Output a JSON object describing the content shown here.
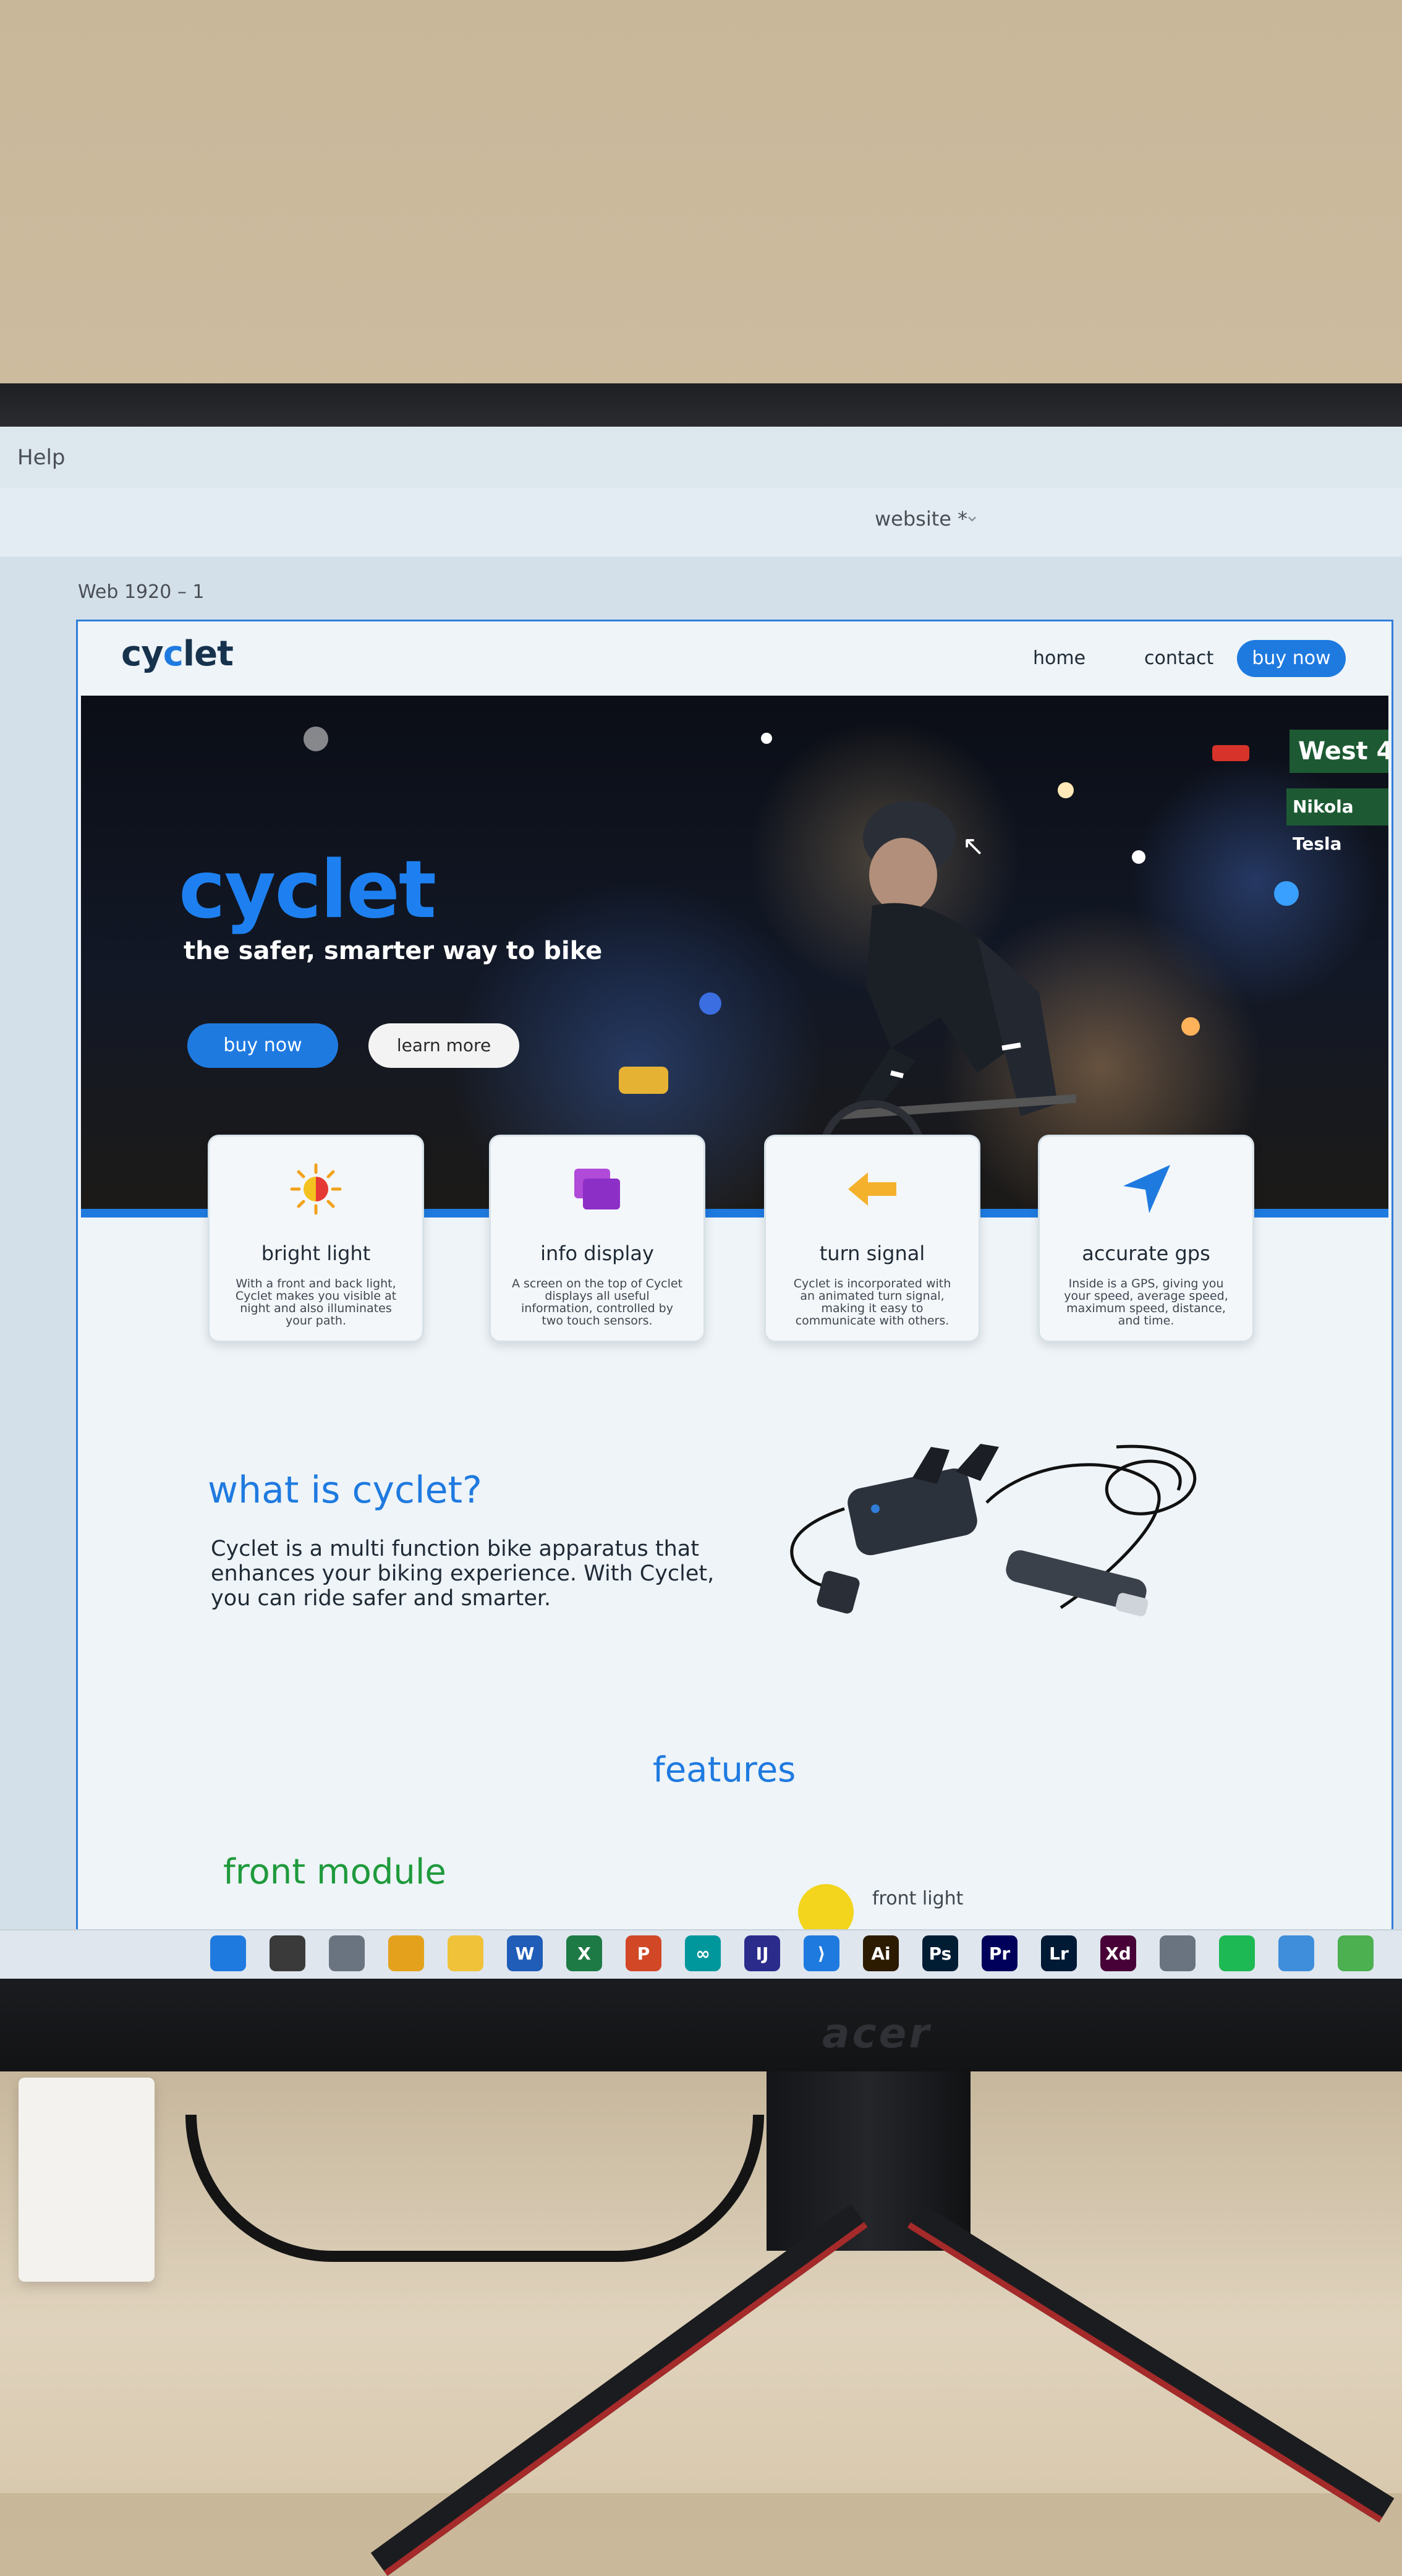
{
  "app": {
    "menu": {
      "help": "Help"
    },
    "document": {
      "title": "website *",
      "chevron": "⌄"
    },
    "artboard_label": "Web 1920 – 1"
  },
  "site": {
    "logo": {
      "prefix": "cy",
      "accent": "c",
      "suffix": "let"
    },
    "nav": {
      "home": "home",
      "contact": "contact",
      "buy": "buy now"
    },
    "hero": {
      "title": "cyclet",
      "subtitle": "the safer, smarter way to bike",
      "buy": "buy now",
      "learn": "learn more",
      "sign_main": "West 4",
      "sign_second": "Nikola Tesla"
    },
    "features": [
      {
        "icon": "sun-icon",
        "title": "bright light",
        "text": "With a front and back light, Cyclet makes you visible at night and also illuminates your path."
      },
      {
        "icon": "screens-icon",
        "title": "info display",
        "text": "A screen on the top of Cyclet displays all useful information, controlled by two touch sensors."
      },
      {
        "icon": "arrow-left-icon",
        "title": "turn signal",
        "text": "Cyclet is incorporated with an animated turn signal, making it easy to communicate with others."
      },
      {
        "icon": "navigation-icon",
        "title": "accurate gps",
        "text": "Inside is a GPS, giving you your speed, average speed, maximum speed, distance, and time."
      }
    ],
    "what": {
      "title": "what is cyclet?",
      "body": "Cyclet is a multi function bike apparatus that enhances your biking experience. With Cyclet, you can ride safer and smarter."
    },
    "features_title": "features",
    "front_module": "front module",
    "front_light": "front light"
  },
  "taskbar": {
    "icons": [
      {
        "name": "windows-start-icon",
        "label": "",
        "color": "#1f7ae0"
      },
      {
        "name": "search-icon",
        "label": "",
        "color": "#3a3a3a"
      },
      {
        "name": "task-view-icon",
        "label": "",
        "color": "#6a7480"
      },
      {
        "name": "chrome-icon",
        "label": "",
        "color": "#e4a21c"
      },
      {
        "name": "file-explorer-icon",
        "label": "",
        "color": "#f0c23a"
      },
      {
        "name": "word-icon",
        "label": "W",
        "color": "#1f5db8"
      },
      {
        "name": "excel-icon",
        "label": "X",
        "color": "#1e7a45"
      },
      {
        "name": "powerpoint-icon",
        "label": "P",
        "color": "#d24726"
      },
      {
        "name": "arduino-icon",
        "label": "∞",
        "color": "#00979c"
      },
      {
        "name": "intellij-icon",
        "label": "IJ",
        "color": "#2b2b8c"
      },
      {
        "name": "vscode-icon",
        "label": "⟩",
        "color": "#1f7ae0"
      },
      {
        "name": "illustrator-icon",
        "label": "Ai",
        "color": "#2d1b00"
      },
      {
        "name": "photoshop-icon",
        "label": "Ps",
        "color": "#001d34"
      },
      {
        "name": "premiere-icon",
        "label": "Pr",
        "color": "#00005b"
      },
      {
        "name": "lightroom-icon",
        "label": "Lr",
        "color": "#001a35"
      },
      {
        "name": "xd-icon",
        "label": "Xd",
        "color": "#470137"
      },
      {
        "name": "arduino-ide-icon",
        "label": "",
        "color": "#6a7480"
      },
      {
        "name": "spotify-icon",
        "label": "",
        "color": "#1db954"
      },
      {
        "name": "notepad-icon",
        "label": "",
        "color": "#3e8edc"
      },
      {
        "name": "image-viewer-icon",
        "label": "",
        "color": "#4caf50"
      }
    ]
  },
  "colors": {
    "brand": "#1f7ae0",
    "green_heading": "#1f9a3c",
    "hero_bar": "#1f7ae0"
  },
  "monitor": {
    "brand": "acer"
  }
}
